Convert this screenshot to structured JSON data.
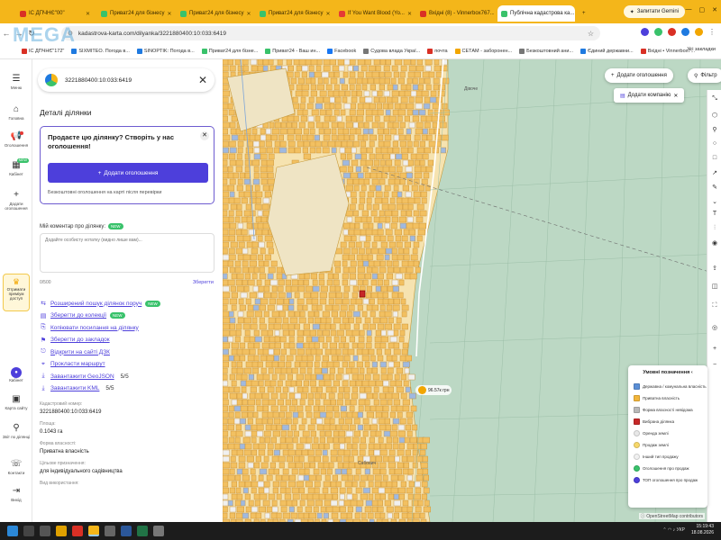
{
  "browser": {
    "tabs": [
      {
        "label": "ІС ДПЧНЄ\"00\"",
        "color": "#d93025"
      },
      {
        "label": "Приват24 для бізнесу",
        "color": "#39c26b"
      },
      {
        "label": "Приват24 для бізнесу",
        "color": "#39c26b"
      },
      {
        "label": "Приват24 для бізнесу",
        "color": "#39c26b"
      },
      {
        "label": "If You Want Blood (Yo...",
        "color": "#e53935"
      },
      {
        "label": "Вхідні (8) - Vinnerbox767...",
        "color": "#d93025"
      },
      {
        "label": "Публічна кадастрова ка...",
        "color": "#39c26b",
        "active": true
      }
    ],
    "gemini_label": "Запитати Gemini",
    "address": "kadastrova-karta.com/dilyanka/3221880400:10:033:6419",
    "bookmarks": [
      "ІС ДПЧНЄ\"172\"",
      "SIXMITEO. Погода в...",
      "SINOPTIK: Погода в...",
      "Приват24 для бізне...",
      "Приват24 - Ваш ин...",
      "Facebook",
      "Судова влада Украї...",
      "почта",
      "СЕТАМ - заборонен...",
      "Безкоштовний ани...",
      "Єдиний державни...",
      "Вхідні • Vinnerbox7..."
    ],
    "all_bookmarks": "Усі закладки"
  },
  "rail": {
    "menu": "Меню",
    "home": "Головна",
    "ads": "Оголошення",
    "cabinet_new": "NEW",
    "cabinet": "Кабінет",
    "add": "Додати оголошення",
    "premium": "Отримати преміум доступ",
    "account": "Кабінет",
    "map_help": "Карта сайту",
    "partner": "Звіт по ділянці",
    "contacts": "Контакти",
    "logout": "Вихід"
  },
  "panel": {
    "search_value": "3221880400:10:033:6419",
    "details_title": "Деталі ділянки",
    "promo": {
      "title": "Продаєте цю ділянку? Створіть у нас оголошення!",
      "button": "Додати оголошення",
      "note": "Безкоштовні оголошення на карті після перевірки"
    },
    "comment_label": "Мій коментар про ділянку:",
    "comment_new": "NEW",
    "comment_placeholder": "Додайте особисту нотатку (видно лише вам)...",
    "counter": "0/500",
    "save": "Зберегти",
    "actions": [
      {
        "icon": "⇆",
        "label": "Розширений пошук ділянок поруч",
        "pill": "NEW"
      },
      {
        "icon": "▤",
        "label": "Зберегти до колекції",
        "pill": "NEW"
      },
      {
        "icon": "⎘",
        "label": "Копіювати посилання на ділянку"
      },
      {
        "icon": "⚑",
        "label": "Зберегти до закладок"
      },
      {
        "icon": "⎋",
        "label": "Відкрити на сайті ДЗК"
      },
      {
        "icon": "⌖",
        "label": "Прокласти маршрут"
      },
      {
        "icon": "⤓",
        "label": "Завантажити GeoJSON",
        "count": "5/5"
      },
      {
        "icon": "⤓",
        "label": "Завантажити KML",
        "count": "5/5"
      }
    ],
    "fields": [
      {
        "label": "Кадастровий номер:",
        "value": "3221880400:10:033:6419"
      },
      {
        "label": "Площа:",
        "value": "0.1043 га"
      },
      {
        "label": "Форма власності:",
        "value": "Приватна власність"
      },
      {
        "label": "Цільове призначення:",
        "value": "для індивідуального садівництва"
      },
      {
        "label": "Вид використання:",
        "value": ""
      }
    ]
  },
  "map": {
    "add_listing": "Додати оголошення",
    "filters": "Фільтр",
    "add_company": "Додати компанію",
    "price_pin": "96.57к грн",
    "place_1": "Сабович",
    "place_2": "Дівоче",
    "legend": {
      "title": "Умовні позначення",
      "items": [
        {
          "label": "Державна / комунальна власність",
          "color": "#5b8fd6"
        },
        {
          "label": "Приватна власність",
          "color": "#f2b53a"
        },
        {
          "label": "Форма власності невідома",
          "color": "#b9b9b9"
        },
        {
          "label": "Вибрана ділянка",
          "color": "#c62828"
        },
        {
          "label": "Оренда землі",
          "color": "#e8e8e8",
          "round": true
        },
        {
          "label": "Продаж землі",
          "color": "#f7d86a",
          "round": true
        },
        {
          "label": "Інший тип продажу",
          "color": "#f1f1f1",
          "round": true
        },
        {
          "label": "Оголошення про продаж",
          "color": "#39c26b",
          "round": true
        },
        {
          "label": "ТОП оголошення про продаж",
          "color": "#4d3fdb",
          "round": true
        }
      ]
    },
    "attribution": "OpenStreetMap contributors"
  },
  "taskbar": {
    "time": "15:19:43",
    "date": "18.08.2026",
    "lang": "УКР"
  }
}
